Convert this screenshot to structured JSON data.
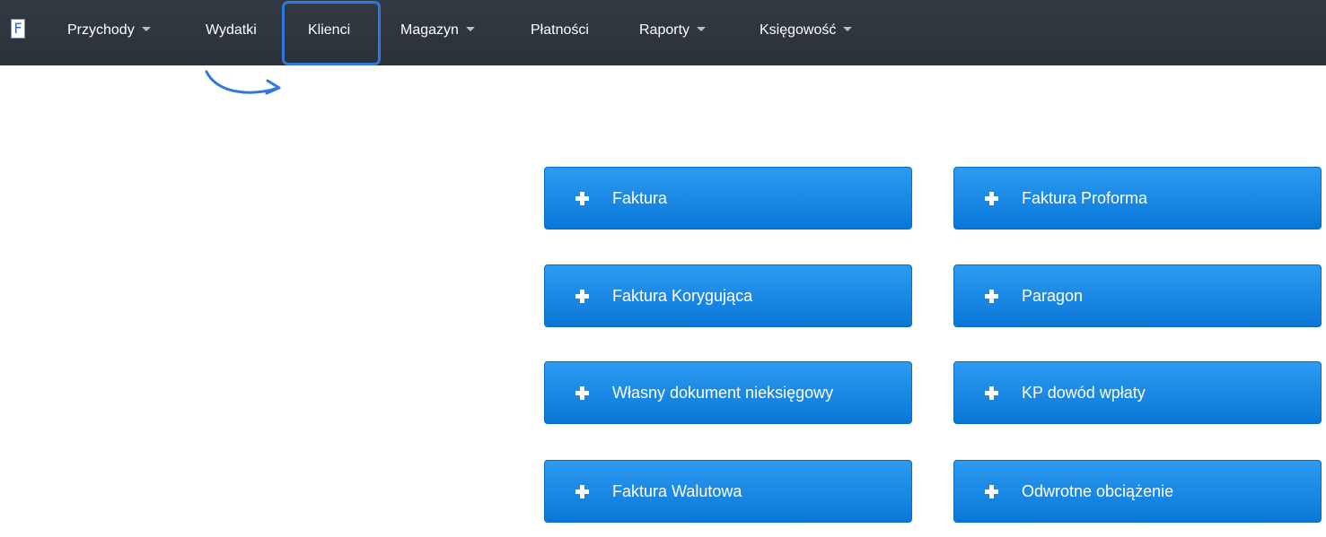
{
  "logo": {
    "letter": "F",
    "icon": "app-logo-icon"
  },
  "nav": {
    "items": [
      {
        "label": "Przychody",
        "dropdown": true
      },
      {
        "label": "Wydatki",
        "dropdown": false
      },
      {
        "label": "Klienci",
        "dropdown": false,
        "highlighted": true
      },
      {
        "label": "Magazyn",
        "dropdown": true
      },
      {
        "label": "Płatności",
        "dropdown": false
      },
      {
        "label": "Raporty",
        "dropdown": true
      },
      {
        "label": "Księgowość",
        "dropdown": true
      }
    ]
  },
  "buttons": {
    "faktura": "Faktura",
    "faktura_proforma": "Faktura Proforma",
    "faktura_korygujaca": "Faktura Korygująca",
    "paragon": "Paragon",
    "wlasny_dokument": "Własny dokument nieksięgowy",
    "kp_dowod_wplaty": "KP dowód wpłaty",
    "faktura_walutowa": "Faktura Walutowa",
    "odwrotne_obciazenie": "Odwrotne obciążenie"
  },
  "colors": {
    "navbar": "#2f353c",
    "button": "#1a87e6",
    "highlight": "#2f78e0"
  }
}
